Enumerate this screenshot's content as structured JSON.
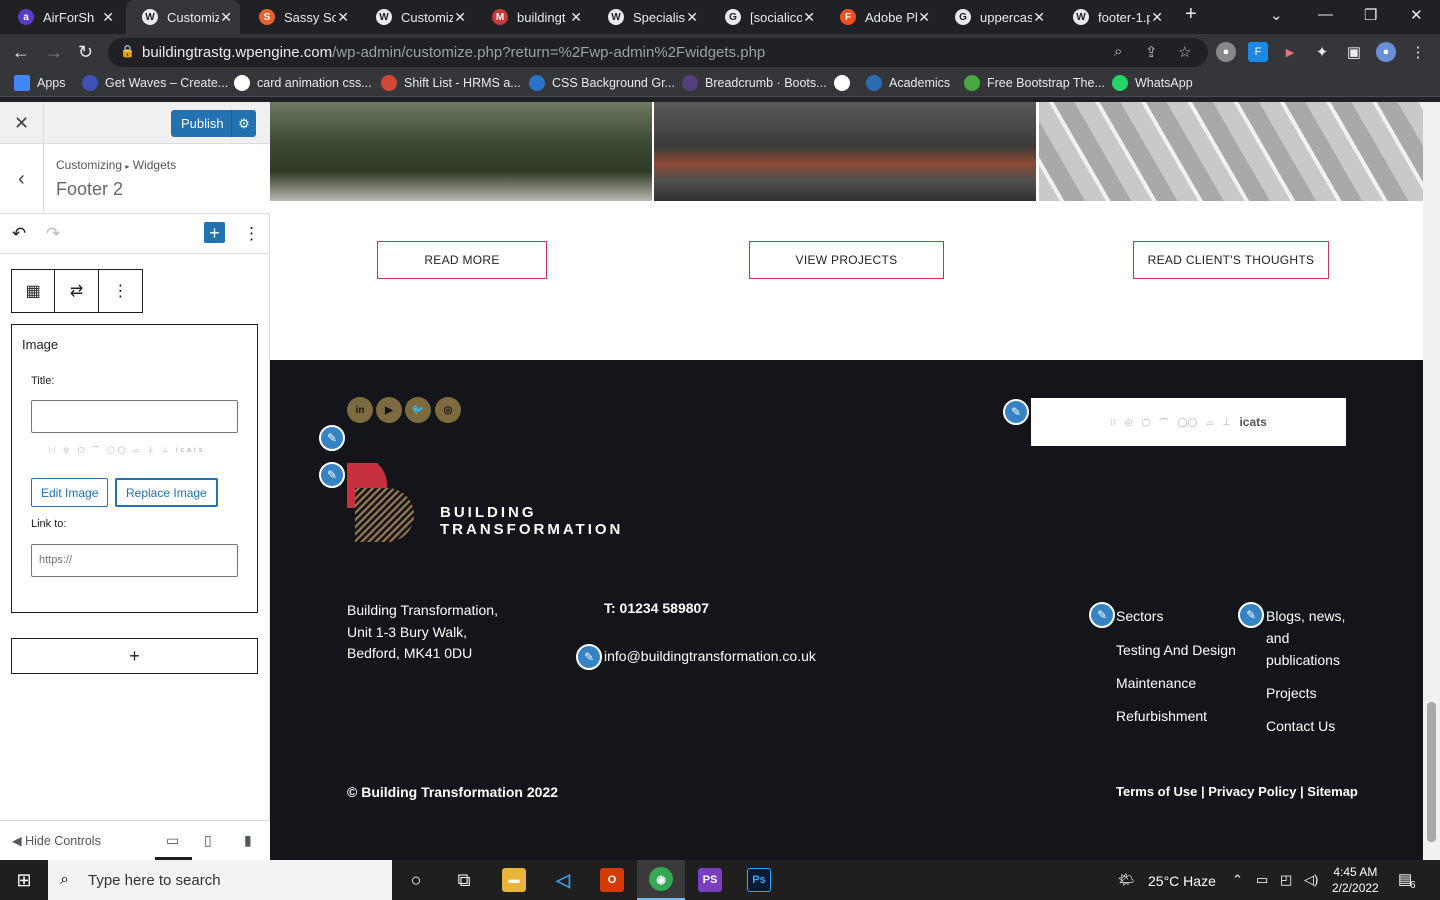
{
  "browser": {
    "tabs": [
      {
        "title": "AirForSha",
        "fav": "a",
        "color": "#5b3cc4"
      },
      {
        "title": "Customiz",
        "fav": "W",
        "color": "#e8eaed",
        "active": true
      },
      {
        "title": "Sassy Soc",
        "fav": "S",
        "color": "#e8622c"
      },
      {
        "title": "Customiz",
        "fav": "W",
        "color": "#e8eaed"
      },
      {
        "title": "buildingt",
        "fav": "M",
        "color": "#c9383a"
      },
      {
        "title": "Specialist",
        "fav": "W",
        "color": "#e8eaed"
      },
      {
        "title": "[socialico",
        "fav": "G",
        "color": "#e8eaed"
      },
      {
        "title": "Adobe Ph",
        "fav": "F",
        "color": "#f24e1e"
      },
      {
        "title": "uppercas",
        "fav": "G",
        "color": "#e8eaed"
      },
      {
        "title": "footer-1.p",
        "fav": "W",
        "color": "#e8eaed"
      }
    ],
    "url_host": "buildingtrastg.wpengine.com",
    "url_path": "/wp-admin/customize.php?return=%2Fwp-admin%2Fwidgets.php",
    "bookmarks": [
      {
        "label": "Apps",
        "color": "#4285f4"
      },
      {
        "label": "Get Waves – Create...",
        "color": "#3f51b5"
      },
      {
        "label": "card animation css...",
        "color": "#ffffff"
      },
      {
        "label": "Shift List - HRMS a...",
        "color": "#d14836"
      },
      {
        "label": "CSS Background Gr...",
        "color": "#2a73c9"
      },
      {
        "label": "Breadcrumb · Boots...",
        "color": "#563d7c"
      },
      {
        "label": "",
        "color": "#ffffff"
      },
      {
        "label": "Academics",
        "color": "#2b6cb0"
      },
      {
        "label": "Free Bootstrap The...",
        "color": "#49a942"
      },
      {
        "label": "WhatsApp",
        "color": "#25d366"
      }
    ]
  },
  "customizer": {
    "publish_label": "Publish",
    "breadcrumb_a": "Customizing",
    "breadcrumb_b": "Widgets",
    "section_title": "Footer 2",
    "block_heading": "Image",
    "title_label": "Title:",
    "title_value": "",
    "edit_image": "Edit Image",
    "replace_image": "Replace Image",
    "link_label": "Link to:",
    "link_placeholder": "https://",
    "add_block": "+",
    "hide_controls": "Hide Controls"
  },
  "site": {
    "cta_buttons": [
      "READ MORE",
      "VIEW PROJECTS",
      "READ CLIENT'S THOUGHTS"
    ],
    "social_icons": [
      "linkedin-icon",
      "youtube-icon",
      "twitter-icon",
      "instagram-icon"
    ],
    "brand_line1": "BUILDING",
    "brand_line2": "TRANSFORMATION",
    "accreditation_last": "icats",
    "address": [
      "Building Transformation,",
      "Unit 1-3 Bury Walk,",
      "Bedford, MK41 0DU"
    ],
    "phone": "T: 01234 589807",
    "email": "info@buildingtransformation.co.uk",
    "col1": [
      "Sectors",
      "Testing And Design",
      "Maintenance",
      "Refurbishment"
    ],
    "col2": [
      "Blogs, news,",
      "and",
      "publications",
      "Projects",
      "Contact Us"
    ],
    "copyright": "© Building Transformation 2022",
    "legal": "Terms of Use | Privacy Policy | Sitemap"
  },
  "taskbar": {
    "search_placeholder": "Type here to search",
    "weather": "25°C  Haze",
    "time": "4:45 AM",
    "date": "2/2/2022",
    "notif_count": "6"
  }
}
